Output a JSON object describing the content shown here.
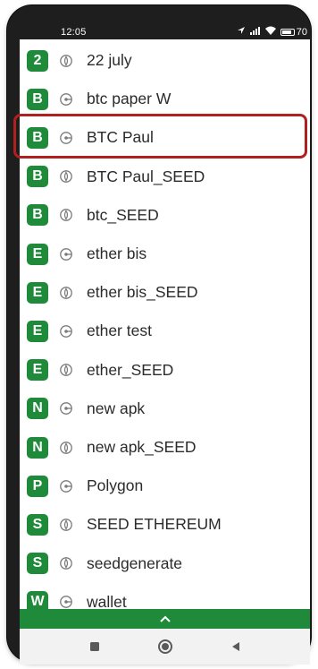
{
  "status_bar": {
    "time": "12:05",
    "battery": "70"
  },
  "list": {
    "items": [
      {
        "badge": "2",
        "icon": "seed-icon",
        "label": "22 july"
      },
      {
        "badge": "B",
        "icon": "key-icon",
        "label": "btc paper W"
      },
      {
        "badge": "B",
        "icon": "key-icon",
        "label": "BTC Paul"
      },
      {
        "badge": "B",
        "icon": "seed-icon",
        "label": "BTC Paul_SEED"
      },
      {
        "badge": "B",
        "icon": "seed-icon",
        "label": "btc_SEED"
      },
      {
        "badge": "E",
        "icon": "key-icon",
        "label": "ether bis"
      },
      {
        "badge": "E",
        "icon": "seed-icon",
        "label": "ether bis_SEED"
      },
      {
        "badge": "E",
        "icon": "key-icon",
        "label": "ether test"
      },
      {
        "badge": "E",
        "icon": "seed-icon",
        "label": "ether_SEED"
      },
      {
        "badge": "N",
        "icon": "key-icon",
        "label": "new apk"
      },
      {
        "badge": "N",
        "icon": "seed-icon",
        "label": "new apk_SEED"
      },
      {
        "badge": "P",
        "icon": "key-icon",
        "label": "Polygon"
      },
      {
        "badge": "S",
        "icon": "seed-icon",
        "label": "SEED ETHEREUM"
      },
      {
        "badge": "S",
        "icon": "seed-icon",
        "label": "seedgenerate"
      },
      {
        "badge": "W",
        "icon": "key-icon",
        "label": "wallet"
      }
    ]
  },
  "colors": {
    "badge": "#1f8a3a",
    "highlight": "#b0201c",
    "bottom_bar": "#1f8a3a"
  },
  "bottom_bar": {
    "icon": "chevron-up-icon"
  },
  "nav": {
    "back": "back-triangle-icon",
    "home": "home-circle-icon",
    "recents": "recents-square-icon"
  }
}
